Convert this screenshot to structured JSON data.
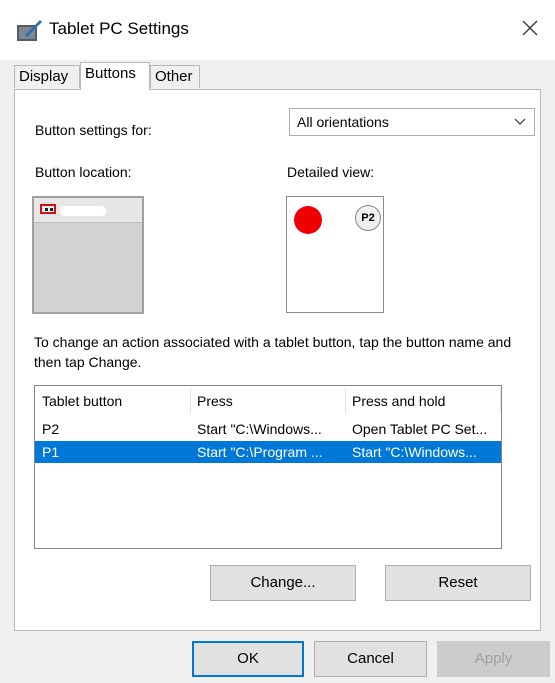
{
  "window": {
    "title": "Tablet PC Settings"
  },
  "tabs": [
    {
      "label": "Display",
      "active": false
    },
    {
      "label": "Buttons",
      "active": true
    },
    {
      "label": "Other",
      "active": false
    }
  ],
  "buttons_tab": {
    "settings_for_label": "Button settings for:",
    "orientation_select": {
      "value": "All orientations"
    },
    "location_label": "Button location:",
    "detail_label": "Detailed view:",
    "detail_badge": "P2",
    "instructions": "To change an action associated with a tablet button, tap the button name and then tap Change.",
    "table": {
      "headers": [
        "Tablet button",
        "Press",
        "Press and hold"
      ],
      "rows": [
        {
          "cells": [
            "P2",
            "Start \"C:\\Windows...",
            "Open Tablet PC Set..."
          ],
          "selected": false
        },
        {
          "cells": [
            "P1",
            "Start \"C:\\Program ...",
            "Start \"C:\\Windows..."
          ],
          "selected": true
        }
      ]
    },
    "change_label": "Change...",
    "reset_label": "Reset"
  },
  "footer": {
    "ok_label": "OK",
    "cancel_label": "Cancel",
    "apply_label": "Apply"
  },
  "colors": {
    "selection": "#0078d7",
    "indicator": "#ee0000"
  },
  "icons": {
    "app": "tablet-pc-icon",
    "close": "close-icon",
    "dropdown": "chevron-down-icon"
  }
}
